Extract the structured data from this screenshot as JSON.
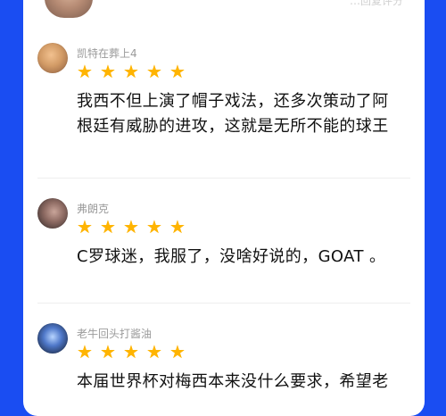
{
  "ui": {
    "top_right_text": "…回复评分"
  },
  "reviews": [
    {
      "username": "凯特在葬上4",
      "rating": 5,
      "content": "我西不但上演了帽子戏法，还多次策动了阿\n根廷有威胁的进攻，这就是无所不能的球王"
    },
    {
      "username": "弗朗克",
      "rating": 5,
      "content": "C罗球迷，我服了，没啥好说的，GOAT 。"
    },
    {
      "username": "老牛回头打酱油",
      "rating": 5,
      "content": "本届世界杯对梅西本来没什么要求，希望老"
    }
  ]
}
